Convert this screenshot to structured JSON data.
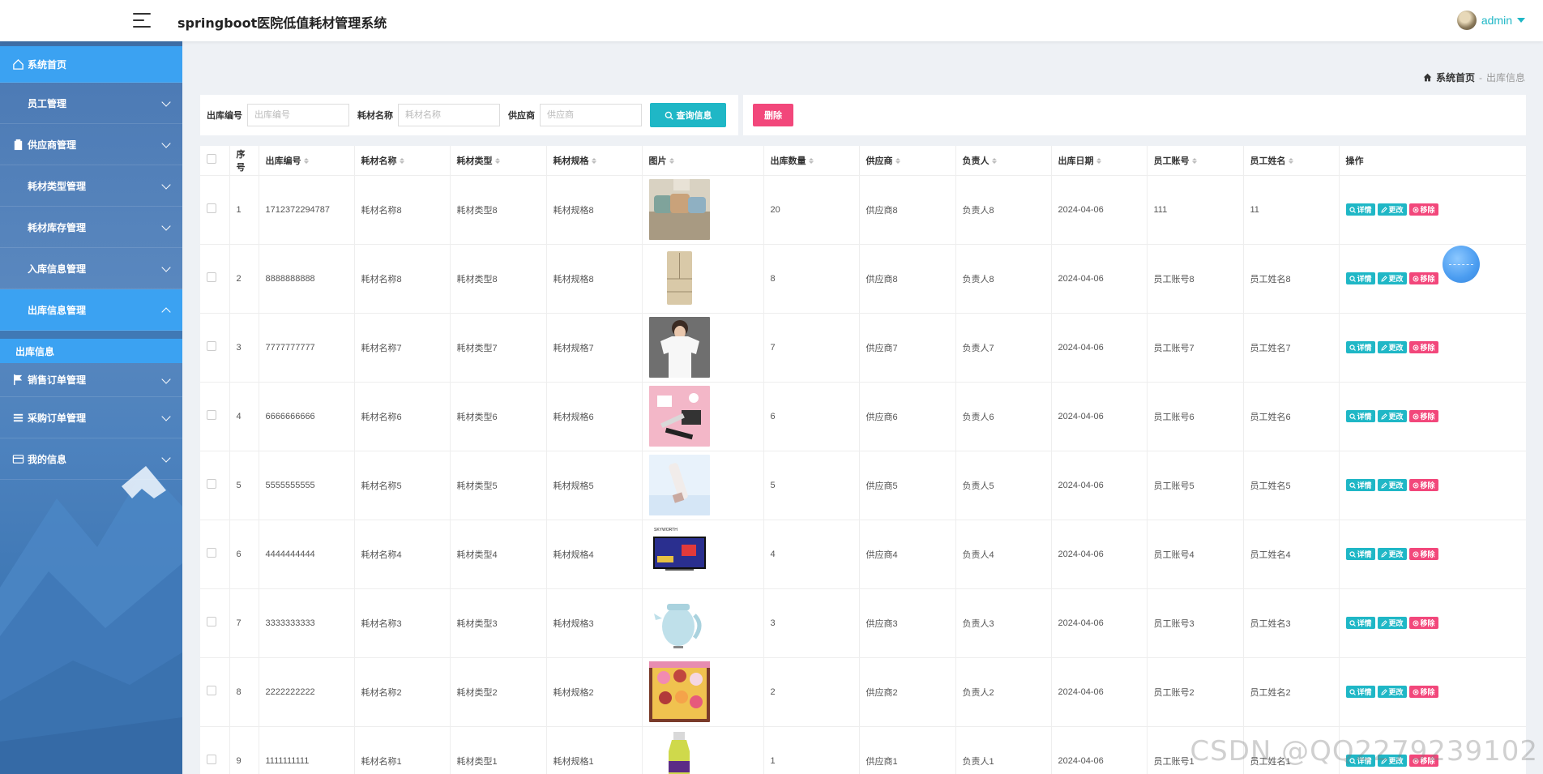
{
  "header": {
    "title": "springboot医院低值耗材管理系统",
    "user": "admin"
  },
  "sidebar": {
    "items": [
      {
        "label": "系统首页",
        "icon": "home-icon",
        "state": "active"
      },
      {
        "label": "员工管理",
        "icon": "grid-icon"
      },
      {
        "label": "供应商管理",
        "icon": "clipboard-icon"
      },
      {
        "label": "耗材类型管理",
        "icon": "grid-icon"
      },
      {
        "label": "耗材库存管理",
        "icon": "grid-icon"
      },
      {
        "label": "入库信息管理",
        "icon": "grid-icon"
      },
      {
        "label": "出库信息管理",
        "icon": "grid-icon",
        "state": "open"
      },
      {
        "label": "销售订单管理",
        "icon": "flag-icon"
      },
      {
        "label": "采购订单管理",
        "icon": "list-icon"
      },
      {
        "label": "我的信息",
        "icon": "card-icon"
      }
    ],
    "submenu": {
      "label": "出库信息"
    }
  },
  "breadcrumb": {
    "home": "系统首页",
    "sep": "-",
    "current": "出库信息"
  },
  "search": {
    "f1_label": "出库编号",
    "f1_placeholder": "出库编号",
    "f2_label": "耗材名称",
    "f2_placeholder": "耗材名称",
    "f3_label": "供应商",
    "f3_placeholder": "供应商",
    "button": "查询信息"
  },
  "actions": {
    "delete": "删除"
  },
  "table": {
    "headers": [
      "序号",
      "出库编号",
      "耗材名称",
      "耗材类型",
      "耗材规格",
      "图片",
      "出库数量",
      "供应商",
      "负责人",
      "出库日期",
      "员工账号",
      "员工姓名",
      "操作"
    ],
    "ops": {
      "detail": "详情",
      "edit": "更改",
      "remove": "移除"
    },
    "rows": [
      {
        "no": "1",
        "code": "1712372294787",
        "name": "耗材名称8",
        "type": "耗材类型8",
        "spec": "耗材规格8",
        "img": "sofa-image",
        "qty": "20",
        "supplier": "供应商8",
        "owner": "负责人8",
        "date": "2024-04-06",
        "account": "111",
        "staff": "11"
      },
      {
        "no": "2",
        "code": "8888888888",
        "name": "耗材名称8",
        "type": "耗材类型8",
        "spec": "耗材规格8",
        "img": "fridge-image",
        "qty": "8",
        "supplier": "供应商8",
        "owner": "负责人8",
        "date": "2024-04-06",
        "account": "员工账号8",
        "staff": "员工姓名8"
      },
      {
        "no": "3",
        "code": "7777777777",
        "name": "耗材名称7",
        "type": "耗材类型7",
        "spec": "耗材规格7",
        "img": "tshirt-image",
        "qty": "7",
        "supplier": "供应商7",
        "owner": "负责人7",
        "date": "2024-04-06",
        "account": "员工账号7",
        "staff": "员工姓名7"
      },
      {
        "no": "4",
        "code": "6666666666",
        "name": "耗材名称6",
        "type": "耗材类型6",
        "spec": "耗材规格6",
        "img": "cosmetics-image",
        "qty": "6",
        "supplier": "供应商6",
        "owner": "负责人6",
        "date": "2024-04-06",
        "account": "员工账号6",
        "staff": "员工姓名6"
      },
      {
        "no": "5",
        "code": "5555555555",
        "name": "耗材名称5",
        "type": "耗材类型5",
        "spec": "耗材规格5",
        "img": "bottle-image",
        "qty": "5",
        "supplier": "供应商5",
        "owner": "负责人5",
        "date": "2024-04-06",
        "account": "员工账号5",
        "staff": "员工姓名5"
      },
      {
        "no": "6",
        "code": "4444444444",
        "name": "耗材名称4",
        "type": "耗材类型4",
        "spec": "耗材规格4",
        "img": "tv-image",
        "qty": "4",
        "supplier": "供应商4",
        "owner": "负责人4",
        "date": "2024-04-06",
        "account": "员工账号4",
        "staff": "员工姓名4"
      },
      {
        "no": "7",
        "code": "3333333333",
        "name": "耗材名称3",
        "type": "耗材类型3",
        "spec": "耗材规格3",
        "img": "kettle-image",
        "qty": "3",
        "supplier": "供应商3",
        "owner": "负责人3",
        "date": "2024-04-06",
        "account": "员工账号3",
        "staff": "员工姓名3"
      },
      {
        "no": "8",
        "code": "2222222222",
        "name": "耗材名称2",
        "type": "耗材类型2",
        "spec": "耗材规格2",
        "img": "giftbox-image",
        "qty": "2",
        "supplier": "供应商2",
        "owner": "负责人2",
        "date": "2024-04-06",
        "account": "员工账号2",
        "staff": "员工姓名2"
      },
      {
        "no": "9",
        "code": "1111111111",
        "name": "耗材名称1",
        "type": "耗材类型1",
        "spec": "耗材规格1",
        "img": "drink-image",
        "qty": "1",
        "supplier": "供应商1",
        "owner": "负责人1",
        "date": "2024-04-06",
        "account": "员工账号1",
        "staff": "员工姓名1"
      }
    ]
  },
  "watermark": "CSDN @QQ2279239102"
}
